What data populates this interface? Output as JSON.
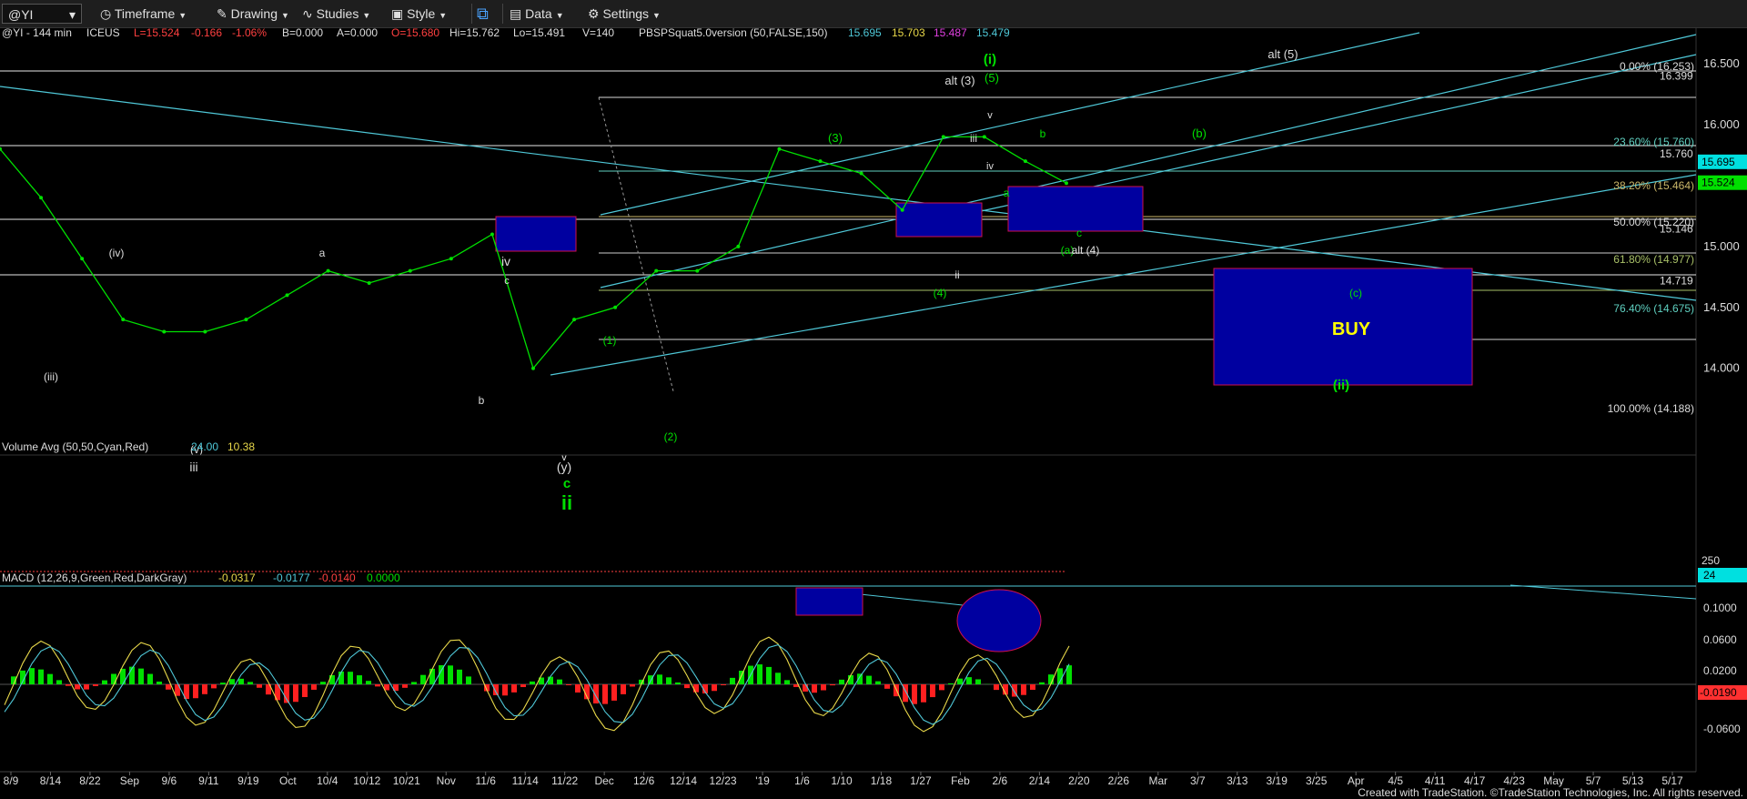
{
  "toolbar": {
    "symbol": "@YI",
    "timeframe": "Timeframe",
    "drawing": "Drawing",
    "studies": "Studies",
    "style": "Style",
    "data": "Data",
    "settings": "Settings"
  },
  "status": {
    "symbol": "@YI - 144 min",
    "exchange": "ICEUS",
    "last": "L=15.524",
    "change": "-0.166",
    "pct": "-1.06%",
    "bid": "B=0.000",
    "ask": "A=0.000",
    "open": "O=15.680",
    "high": "Hi=15.762",
    "low": "Lo=15.491",
    "vol": "V=140",
    "indicator": "PBSPSquat5.0version (50,FALSE,150)",
    "v1": "15.695",
    "v2": "15.703",
    "v3": "15.487",
    "v4": "15.479"
  },
  "volume_panel": {
    "title": "Volume Avg (50,50,Cyan,Red)",
    "v1": "24.00",
    "v2": "10.38",
    "axis_top": "250",
    "axis_badge": "24"
  },
  "macd_panel": {
    "title": "MACD (12,26,9,Green,Red,DarkGray)",
    "v1": "-0.0317",
    "v2": "-0.0177",
    "v3": "-0.0140",
    "v4": "0.0000",
    "badge": "-0.0190"
  },
  "footer": "Created with TradeStation. ©TradeStation Technologies, Inc. All rights reserved.",
  "colors": {
    "bg": "#000000",
    "price": "#00e000",
    "cyan": "#4fc8d8",
    "box": "#0000a0",
    "boxBorder": "#d0104c",
    "white": "#e8e8e8"
  },
  "chart_data": [
    {
      "type": "line",
      "title": "@YI - 144 min",
      "x": [
        "8/9",
        "8/14",
        "8/22",
        "Sep",
        "9/6",
        "9/11",
        "9/19",
        "Oct",
        "10/4",
        "10/12",
        "10/21",
        "Nov",
        "11/6",
        "11/14",
        "11/22",
        "Dec",
        "12/6",
        "12/14",
        "12/23",
        "'19",
        "1/6",
        "1/10",
        "1/18",
        "1/27",
        "Feb",
        "2/6",
        "2/14",
        "2/20",
        "2/26",
        "Mar",
        "3/7",
        "3/13",
        "3/19",
        "3/25",
        "Apr",
        "4/5",
        "4/11",
        "4/17",
        "4/23",
        "May",
        "5/7",
        "5/13",
        "5/17"
      ],
      "ylim": [
        13.4,
        16.65
      ],
      "y_ticks": [
        "16.500",
        "16.000",
        "15.500",
        "15.000",
        "14.500",
        "14.000"
      ],
      "series": [
        {
          "values": [
            15.8,
            15.4,
            14.9,
            14.4,
            14.3,
            14.3,
            14.4,
            14.6,
            14.8,
            14.7,
            14.8,
            14.9,
            15.1,
            14.0,
            14.4,
            14.5,
            14.8,
            14.8,
            15.0,
            15.8,
            15.7,
            15.6,
            15.3,
            15.9,
            15.9,
            15.7,
            15.52
          ]
        }
      ],
      "price_labels": [
        "16.399",
        "15.760",
        "15.695",
        "15.524",
        "15.146",
        "14.719"
      ],
      "fib_levels": [
        "0.00% (16.253)",
        "23.60% (15.760)",
        "38.20% (15.464)",
        "50.00% (15.220)",
        "61.80% (14.977)",
        "76.40% (14.675)",
        "100.00% (14.188)"
      ],
      "annotations": [
        "(i)",
        "(5)",
        "alt (3)",
        "alt (5)",
        "(b)",
        "(3)",
        "iii",
        "iv",
        "v",
        "b",
        "a",
        "c",
        "(a)",
        "alt (4)",
        "(4)",
        "ii",
        "(iv)",
        "(iii)",
        "(v)",
        "iii",
        "a",
        "iv",
        "c",
        "b",
        "(1)",
        "(2)",
        "v",
        "(y)",
        "c",
        "ii",
        "(c)",
        "BUY",
        "(ii)"
      ]
    },
    {
      "type": "bar",
      "title": "Volume Avg (50,50,Cyan,Red)",
      "values": [
        24.0,
        10.38
      ]
    },
    {
      "type": "bar",
      "title": "MACD (12,26,9,Green,Red,DarkGray)",
      "y_ticks": [
        "0.1000",
        "0.0600",
        "0.0200",
        "-0.0600"
      ],
      "values": [
        -0.0317,
        -0.0177,
        -0.014,
        0.0
      ]
    }
  ]
}
